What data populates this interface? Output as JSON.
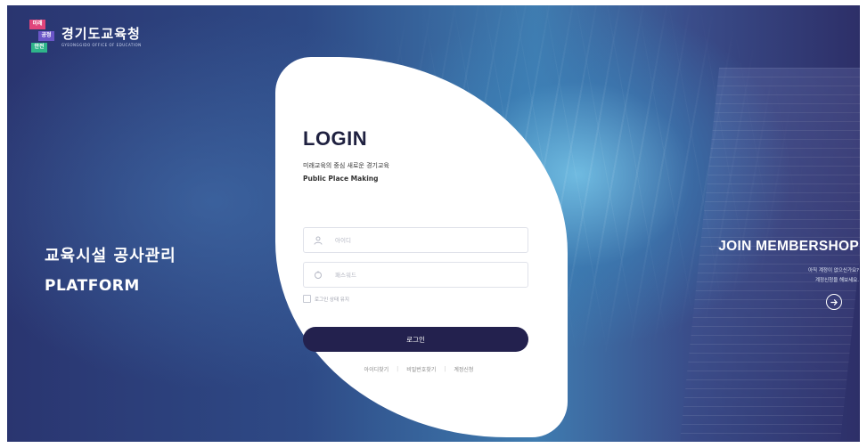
{
  "brand": {
    "mark_words": [
      "미래",
      "공정",
      "안전"
    ],
    "mark_colors": [
      "#e0457b",
      "#6b56c8",
      "#2fb58a"
    ],
    "name": "경기도교육청",
    "subtitle": "GYEONGGIDO OFFICE OF EDUCATION"
  },
  "left_panel": {
    "title_ko": "교육시설 공사관리",
    "title_en": "PLATFORM"
  },
  "login": {
    "title": "LOGIN",
    "tagline_ko": "미래교육의 중심 새로운 경기교육",
    "tagline_en": "Public Place Making",
    "id_placeholder": "아이디",
    "id_icon": "user-icon",
    "password_placeholder": "패스워드",
    "password_icon": "lock-icon",
    "remember_label": "로그인 상태 유지",
    "submit_label": "로그인",
    "links": [
      "아이디찾기",
      "비밀번호찾기",
      "계정신청"
    ]
  },
  "join": {
    "title": "JOIN MEMBERSHOP",
    "line1": "아직 계정이 없으신가요?",
    "line2": "계정신청을 해보세요.",
    "button_icon": "arrow-right-circle-icon"
  },
  "colors": {
    "button_bg": "#23214e",
    "bg_dark": "#2a3570",
    "bg_light": "#3f7cb0"
  }
}
